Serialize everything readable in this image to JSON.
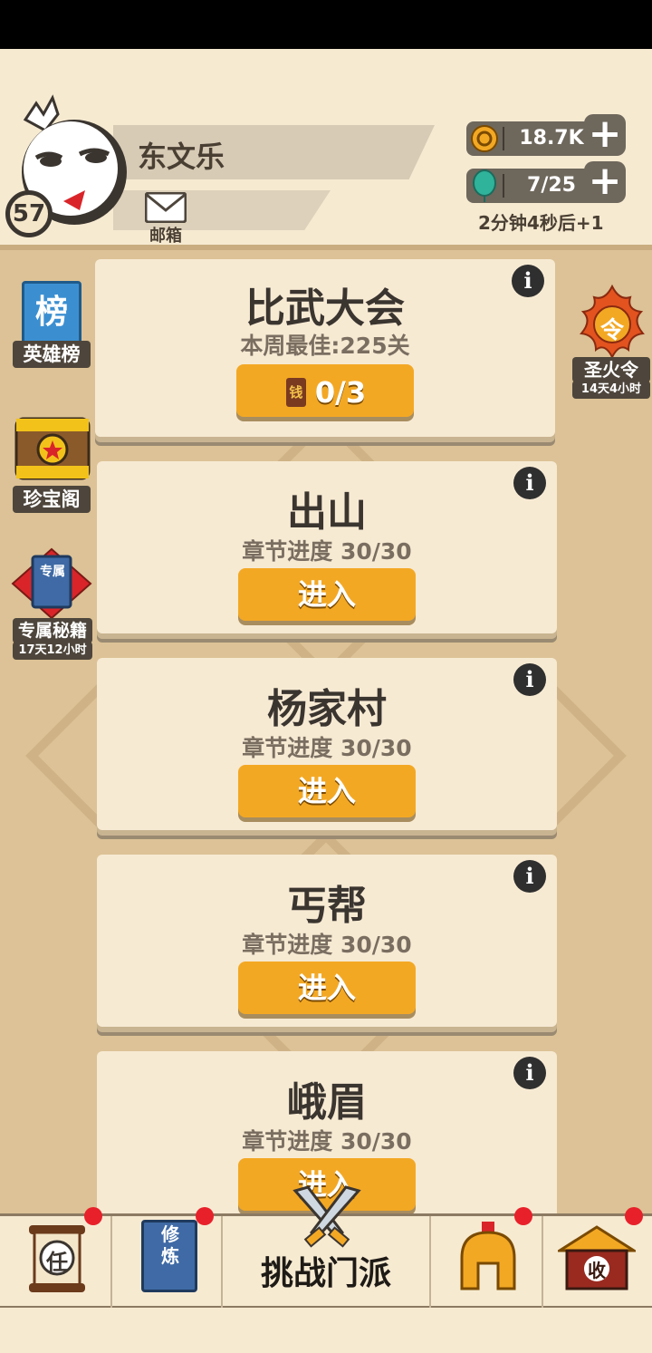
{
  "player": {
    "name": "东文乐",
    "level": "57"
  },
  "mail": {
    "label": "邮箱"
  },
  "resources": {
    "coins": "18.7K",
    "stamina": "7/25",
    "timer": "2分钟4秒后+1"
  },
  "side_left": [
    {
      "glyph": "榜",
      "label": "英雄榜"
    },
    {
      "label": "珍宝阁"
    },
    {
      "glyph": "专属",
      "label": "专属秘籍",
      "sub": "17天12小时"
    }
  ],
  "side_right": {
    "glyph": "令",
    "label": "圣火令",
    "sub": "14天4小时"
  },
  "tournament": {
    "title": "比武大会",
    "best": "本周最佳:225关",
    "ticket_glyph": "钱",
    "tickets": "0/3"
  },
  "chapters": [
    {
      "title": "出山",
      "progress": "章节进度 30/30",
      "button": "进入"
    },
    {
      "title": "杨家村",
      "progress": "章节进度 30/30",
      "button": "进入"
    },
    {
      "title": "丐帮",
      "progress": "章节进度 30/30",
      "button": "进入"
    },
    {
      "title": "峨眉",
      "progress": "章节进度 30/30",
      "button": "进入"
    }
  ],
  "info_glyph": "i",
  "nav": {
    "task_glyph": "任",
    "train_glyph": "修炼",
    "challenge_label": "挑战门派",
    "collect_glyph": "收"
  }
}
